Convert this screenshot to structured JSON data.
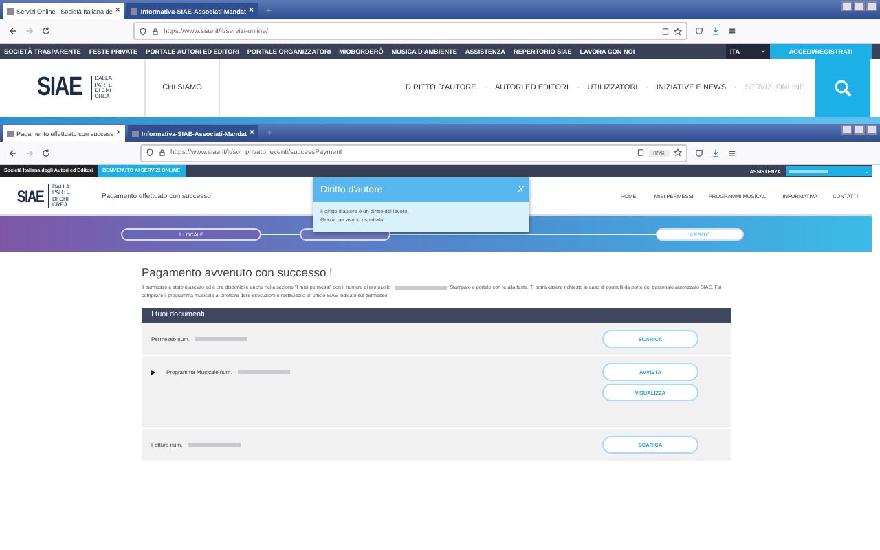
{
  "window_1": {
    "tabs": [
      {
        "label": "Servizi Online | Società Italiana de",
        "selected": true
      },
      {
        "label": "Informativa-SIAE-Associati-Mandat",
        "selected": false
      }
    ],
    "new_tab": "+",
    "tab_close": "×",
    "url": "https://www.siae.it/it/servizi-online/",
    "top_nav": [
      "SOCIETÀ TRASPARENTE",
      "FESTE PRIVATE",
      "PORTALE AUTORI ED EDITORI",
      "PORTALE ORGANIZZATORI",
      "MIOBORDERÒ",
      "MUSICA D'AMBIENTE",
      "ASSISTENZA",
      "REPERTORIO SIAE",
      "LAVORA CON NOI"
    ],
    "language": "ITA",
    "language_caret": "⌄",
    "login": "ACCEDI/REGISTRATI",
    "logo": {
      "mark": "SIAE",
      "tagline": [
        "DALLA",
        "PARTE",
        "DI CHI",
        "CREA"
      ]
    },
    "about": "CHI SIAMO",
    "main_nav": [
      {
        "label": "DIRITTO D'AUTORE",
        "disabled": false
      },
      {
        "label": "AUTORI ED EDITORI",
        "disabled": false
      },
      {
        "label": "UTILIZZATORI",
        "disabled": false
      },
      {
        "label": "INIZIATIVE E NEWS",
        "disabled": false
      },
      {
        "label": "SERVIZI ONLINE",
        "disabled": true
      }
    ],
    "separator": "·"
  },
  "window_2": {
    "tabs": [
      {
        "label": "Pagamento effettuato con success",
        "selected": true
      },
      {
        "label": "Informativa-SIAE-Associati-Mandat",
        "selected": false
      }
    ],
    "new_tab": "+",
    "tab_close": "×",
    "url": "https://www.siae.it/it/sol_privato_eventi/successPayment",
    "zoom": "80%",
    "society": "Società Italiana degli Autori ed Editori",
    "welcome": "BENVENUTO AI SERVIZI ONLINE",
    "help": "ASSISTENZA",
    "user_caret": "⌄",
    "logo": {
      "mark": "SIAE",
      "tagline": [
        "DALLA",
        "PARTE",
        "DI CHI",
        "CREA"
      ]
    },
    "page_title": "Pagamento effettuato con successo",
    "nav": [
      "HOME",
      "I MIEI PERMESSI",
      "PROGRAMMI MUSICALI",
      "INFORMATIVA",
      "CONTATTI"
    ],
    "steps": [
      {
        "label": "1 LOCALE",
        "selected": false
      },
      {
        "label": "4 ESITO",
        "selected": true
      }
    ],
    "popup": {
      "title": "Diritto d'autore",
      "close": "X",
      "lines": [
        "Il diritto d'autore è un diritto del lavoro.",
        "Grazie per averlo rispettato!"
      ]
    },
    "heading": "Pagamento avvenuto con successo !",
    "message_before": "Il permesso è stato rilasciato ed è ora disponibile anche nella sezione \"I miei permessi\" con il numero di protocollo",
    "message_after": ". Stampalo e portalo con te alla festa. Ti potrà essere richiesto in caso di controlli da parte del personale autorizzato SIAE. Fai compilare il programma musicale al direttore delle esecuzioni e restituiscilo all'ufficio SIAE indicato sul permesso.",
    "documents": {
      "title": "I tuoi documenti",
      "rows": [
        {
          "label": "Permesso num.",
          "expandable": false,
          "buttons": [
            "SCARICA"
          ]
        },
        {
          "label": "Programma Musicale num.",
          "expandable": true,
          "buttons": [
            "AVVISTA",
            "VISUALIZZA"
          ]
        },
        {
          "label": "Fattura num.",
          "expandable": false,
          "buttons": [
            "SCARICA"
          ]
        }
      ]
    }
  }
}
